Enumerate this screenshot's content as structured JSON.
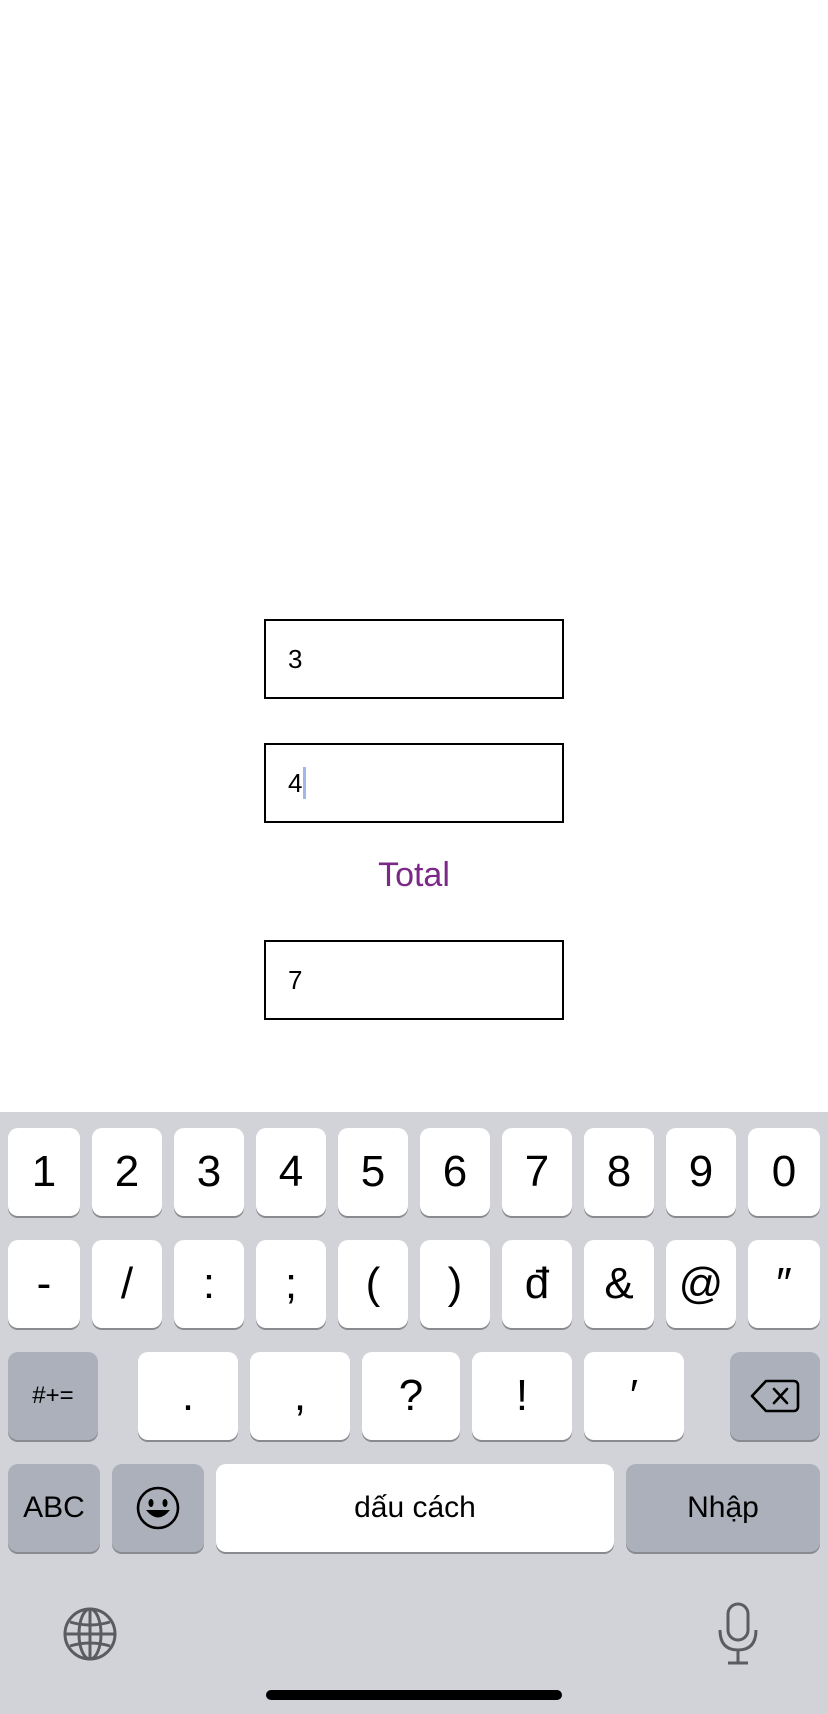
{
  "form": {
    "field_a_value": "3",
    "field_b_value": "4",
    "total_label": "Total",
    "total_value": "7"
  },
  "colors": {
    "total_label": "#7a2a86",
    "keyboard_bg": "#d1d3d9",
    "key_bg": "#ffffff",
    "dark_key_bg": "#abb0ba"
  },
  "keyboard": {
    "row1": [
      "1",
      "2",
      "3",
      "4",
      "5",
      "6",
      "7",
      "8",
      "9",
      "0"
    ],
    "row2": [
      "-",
      "/",
      ":",
      ";",
      "(",
      ")",
      "đ",
      "&",
      "@",
      "″"
    ],
    "row3_left": "#+=",
    "row3": [
      ".",
      ",",
      "?",
      "!",
      "′"
    ],
    "abc": "ABC",
    "space": "dấu cách",
    "enter": "Nhập",
    "icons": {
      "backspace": "backspace-icon",
      "emoji": "emoji-icon",
      "globe": "globe-icon",
      "mic": "microphone-icon"
    }
  }
}
